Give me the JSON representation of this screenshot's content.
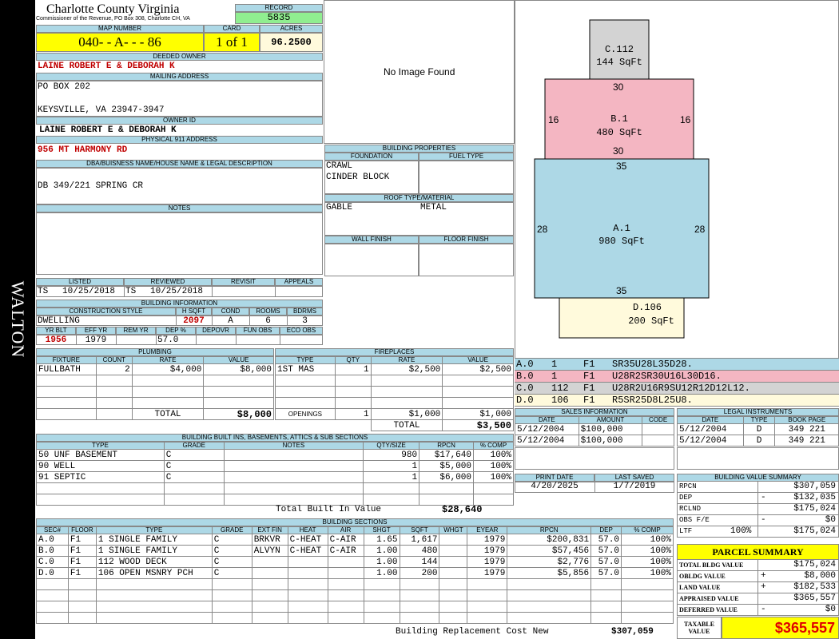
{
  "side_label": "WALTON",
  "header": {
    "county": "Charlotte County Virginia",
    "subtitle": "Commissioner of the Revenue, PO Box 308, Charlotte CH, VA",
    "record_label": "RECORD",
    "record": "5835"
  },
  "parcel": {
    "map_label": "MAP NUMBER",
    "map": "040- - A- - - 86",
    "card_label": "CARD",
    "card": "1 of 1",
    "acres_label": "ACRES",
    "acres": "96.2500"
  },
  "owner": {
    "deeded_label": "DEEDED OWNER",
    "deeded": "LAINE ROBERT E & DEBORAH K",
    "mailing_label": "MAILING ADDRESS",
    "mail1": "PO BOX 202",
    "mail2": "KEYSVILLE, VA 23947-3947",
    "id_label": "OWNER ID",
    "id_value": "LAINE ROBERT E & DEBORAH K",
    "addr_label": "PHYSICAL 911 ADDRESS",
    "address": "956 MT HARMONY RD",
    "dba_label": "DBA/BUISNESS NAME/HOUSE NAME & LEGAL DESCRIPTION",
    "dba": "DB 349/221 SPRING CR",
    "notes_label": "NOTES"
  },
  "image": {
    "text": "No Image Found"
  },
  "building_props": {
    "title": "BUILDING PROPERTIES",
    "foundation_label": "FOUNDATION",
    "fuel_label": "FUEL TYPE",
    "foundation1": "CRAWL",
    "foundation2": "CINDER BLOCK",
    "roof_label": "ROOF TYPE/MATERIAL",
    "roof_type": "GABLE",
    "roof_material": "METAL",
    "wall_label": "WALL FINISH",
    "floor_label": "FLOOR FINISH"
  },
  "listing": {
    "listed_label": "LISTED",
    "reviewed_label": "REVIEWED",
    "revisit_label": "REVISIT",
    "appeals_label": "APPEALS",
    "listed_by": "TS",
    "listed": "10/25/2018",
    "reviewed_by": "TS",
    "reviewed": "10/25/2018"
  },
  "building_info": {
    "title": "BUILDING INFORMATION",
    "style_label": "CONSTRUCTION STYLE",
    "hsqft_label": "H SQFT",
    "cond_label": "COND",
    "rooms_label": "ROOMS",
    "bdrms_label": "BDRMS",
    "style": "DWELLING",
    "hsqft": "2097",
    "cond": "A",
    "rooms": "6",
    "bdrms": "3",
    "yrblt_label": "YR BLT",
    "effyr_label": "EFF YR",
    "remyr_label": "REM YR",
    "dep_label": "DEP %",
    "depovr_label": "DEPOVR",
    "funobs_label": "FUN OBS",
    "ecoobs_label": "ECO OBS",
    "yrblt": "1956",
    "effyr": "1979",
    "dep": "57.0"
  },
  "plumbing": {
    "title": "PLUMBING",
    "headers": [
      "FIXTURE",
      "COUNT",
      "RATE",
      "VALUE"
    ],
    "rows": [
      [
        "FULLBATH",
        "2",
        "$4,000",
        "$8,000"
      ]
    ],
    "total_label": "TOTAL",
    "total": "$8,000"
  },
  "fireplaces": {
    "title": "FIREPLACES",
    "headers": [
      "TYPE",
      "QTY",
      "RATE",
      "VALUE"
    ],
    "rows": [
      [
        "1ST MAS",
        "1",
        "$2,500",
        "$2,500"
      ]
    ],
    "openings_label": "OPENINGS",
    "openings_qty": "1",
    "openings_rate": "$1,000",
    "openings_value": "$1,000",
    "total_label": "TOTAL",
    "total": "$3,500"
  },
  "builtins": {
    "title": "BUILDING BUILT INS, BASEMENTS, ATTICS & SUB SECTIONS",
    "headers": [
      "TYPE",
      "GRADE",
      "NOTES",
      "QTY/SIZE",
      "RPCN",
      "% COMP"
    ],
    "rows": [
      [
        "50 UNF BASEMENT",
        "C",
        "",
        "980",
        "$17,640",
        "100%"
      ],
      [
        "90 WELL",
        "C",
        "",
        "1",
        "$5,000",
        "100%"
      ],
      [
        "91 SEPTIC",
        "C",
        "",
        "1",
        "$6,000",
        "100%"
      ]
    ],
    "total_label": "Total Built In Value",
    "total": "$28,640"
  },
  "sections": {
    "title": "BUILDING SECTIONS",
    "headers": [
      "SEC#",
      "FLOOR",
      "TYPE",
      "GRADE",
      "EXT FIN",
      "HEAT",
      "AIR",
      "SHGT",
      "SQFT",
      "WHGT",
      "EYEAR",
      "RPCN",
      "DEP",
      "% COMP"
    ],
    "rows": [
      [
        "A.0",
        "F1",
        "1 SINGLE FAMILY",
        "C",
        "BRKVR",
        "C-HEAT",
        "C-AIR",
        "1.65",
        "1,617",
        "",
        "1979",
        "$200,831",
        "57.0",
        "100%"
      ],
      [
        "B.0",
        "F1",
        "1 SINGLE FAMILY",
        "C",
        "ALVYN",
        "C-HEAT",
        "C-AIR",
        "1.00",
        "480",
        "",
        "1979",
        "$57,456",
        "57.0",
        "100%"
      ],
      [
        "C.0",
        "F1",
        "112 WOOD DECK",
        "C",
        "",
        "",
        "",
        "1.00",
        "144",
        "",
        "1979",
        "$2,776",
        "57.0",
        "100%"
      ],
      [
        "D.0",
        "F1",
        "106 OPEN MSNRY PCH",
        "C",
        "",
        "",
        "",
        "1.00",
        "200",
        "",
        "1979",
        "$5,856",
        "57.0",
        "100%"
      ]
    ],
    "brcn_label": "Building Replacement Cost New",
    "brcn": "$307,059"
  },
  "sketch": {
    "areas": [
      {
        "label": "C.112",
        "sqft": "144 SqFt",
        "color": "#d3d3d3"
      },
      {
        "label": "B.1",
        "sqft": "480 SqFt",
        "color": "#f4b6c2"
      },
      {
        "label": "A.1",
        "sqft": "980 SqFt",
        "color": "#add8e6"
      },
      {
        "label": "D.106",
        "sqft": "200 SqFt",
        "color": "#fffadc"
      }
    ],
    "dims": {
      "b_top": "30",
      "b_left": "16",
      "b_right": "16",
      "b_bottom": "30",
      "a_top": "35",
      "a_left": "28",
      "a_right": "28",
      "a_bottom": "35"
    }
  },
  "sketch_legend": [
    {
      "sec": "A.0",
      "code": "1",
      "floor": "F1",
      "path": "SR35U28L35D28.",
      "color": "#add8e6"
    },
    {
      "sec": "B.0",
      "code": "1",
      "floor": "F1",
      "path": "U28R2SR30U16L30D16.",
      "color": "#f4b6c2"
    },
    {
      "sec": "C.0",
      "code": "112",
      "floor": "F1",
      "path": "U28R2U16R9SU12R12D12L12.",
      "color": "#d3d3d3"
    },
    {
      "sec": "D.0",
      "code": "106",
      "floor": "F1",
      "path": "R5SR25D8L25U8.",
      "color": "#fffadc"
    }
  ],
  "sales": {
    "title": "SALES INFORMATION",
    "headers": [
      "DATE",
      "AMOUNT",
      "CODE"
    ],
    "rows": [
      [
        "5/12/2004",
        "$100,000",
        ""
      ],
      [
        "5/12/2004",
        "$100,000",
        ""
      ]
    ]
  },
  "legal": {
    "title": "LEGAL INSTRUMENTS",
    "headers": [
      "DATE",
      "TYPE",
      "BOOK PAGE"
    ],
    "rows": [
      [
        "5/12/2004",
        "D",
        "349 221"
      ],
      [
        "5/12/2004",
        "D",
        "349 221"
      ]
    ]
  },
  "dates": {
    "print_label": "PRINT DATE",
    "print": "4/20/2025",
    "saved_label": "LAST SAVED",
    "saved": "1/7/2019"
  },
  "value_summary": {
    "title": "BUILDING VALUE SUMMARY",
    "rows": [
      {
        "label": "RPCN",
        "sign": "",
        "pct": "",
        "value": "$307,059"
      },
      {
        "label": "DEP",
        "sign": "-",
        "pct": "",
        "value": "$132,035"
      },
      {
        "label": "RCLND",
        "sign": "",
        "pct": "",
        "value": "$175,024"
      },
      {
        "label": "OBS F/E",
        "sign": "-",
        "pct": "",
        "value": "$0"
      },
      {
        "label": "LTF",
        "sign": "",
        "pct": "100%",
        "value": "$175,024"
      }
    ]
  },
  "parcel_summary": {
    "title": "PARCEL SUMMARY",
    "rows": [
      {
        "label": "TOTAL BLDG VALUE",
        "sign": "",
        "value": "$175,024"
      },
      {
        "label": "OBLDG VALUE",
        "sign": "+",
        "value": "$8,000"
      },
      {
        "label": "LAND VALUE",
        "sign": "+",
        "value": "$182,533"
      },
      {
        "label": "APPRAISED VALUE",
        "sign": "",
        "value": "$365,557"
      },
      {
        "label": "DEFERRED VALUE",
        "sign": "-",
        "value": "$0"
      }
    ],
    "taxable_label": "TAXABLE VALUE",
    "taxable": "$365,557"
  }
}
